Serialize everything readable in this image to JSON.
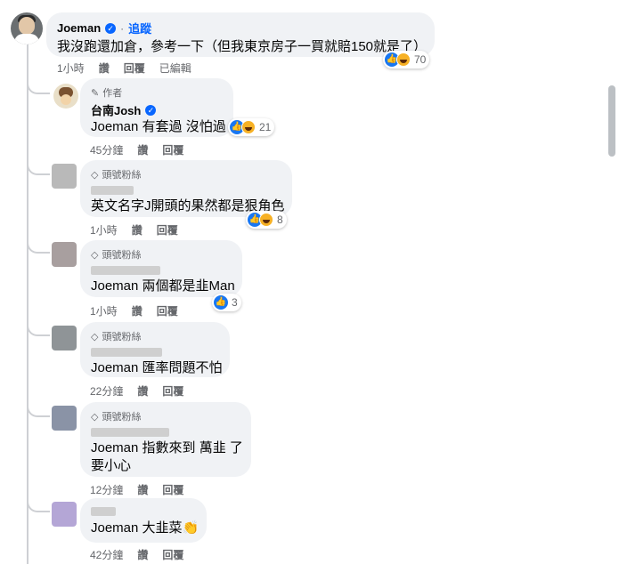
{
  "main": {
    "name": "Joeman",
    "follow": "追蹤",
    "text": "我沒跑還加倉，參考一下（但我東京房子一買就賠150就是了）",
    "reactions": "70",
    "time": "1小時",
    "like": "讚",
    "reply": "回覆",
    "edited": "已編輯"
  },
  "replies": [
    {
      "badge": "作者",
      "name": "台南Josh",
      "text": "Joeman 有套過 沒怕過",
      "reactions": "21",
      "time": "45分鐘",
      "like": "讚",
      "reply": "回覆"
    },
    {
      "badge": "頭號粉絲",
      "text": "英文名字J開頭的果然都是狠角色",
      "reactions": "8",
      "time": "1小時",
      "like": "讚",
      "reply": "回覆"
    },
    {
      "badge": "頭號粉絲",
      "text": "Joeman 兩個都是韭Man",
      "reactions": "3",
      "time": "1小時",
      "like": "讚",
      "reply": "回覆"
    },
    {
      "badge": "頭號粉絲",
      "text": "Joeman 匯率問題不怕",
      "time": "22分鐘",
      "like": "讚",
      "reply": "回覆"
    },
    {
      "badge": "頭號粉絲",
      "text": "Joeman 指數來到 萬韭 了\n要小心",
      "time": "12分鐘",
      "like": "讚",
      "reply": "回覆"
    },
    {
      "text": "Joeman 大韭菜👏",
      "time": "42分鐘",
      "like": "讚",
      "reply": "回覆"
    }
  ],
  "icons": {
    "verified": "verified-badge-icon",
    "author": "pencil-icon",
    "fan": "diamond-icon",
    "like": "thumbs-up-icon",
    "haha": "haha-face-icon"
  },
  "colors": {
    "accent": "#0866ff",
    "bubble": "#f0f2f5",
    "meta": "#65676b"
  }
}
